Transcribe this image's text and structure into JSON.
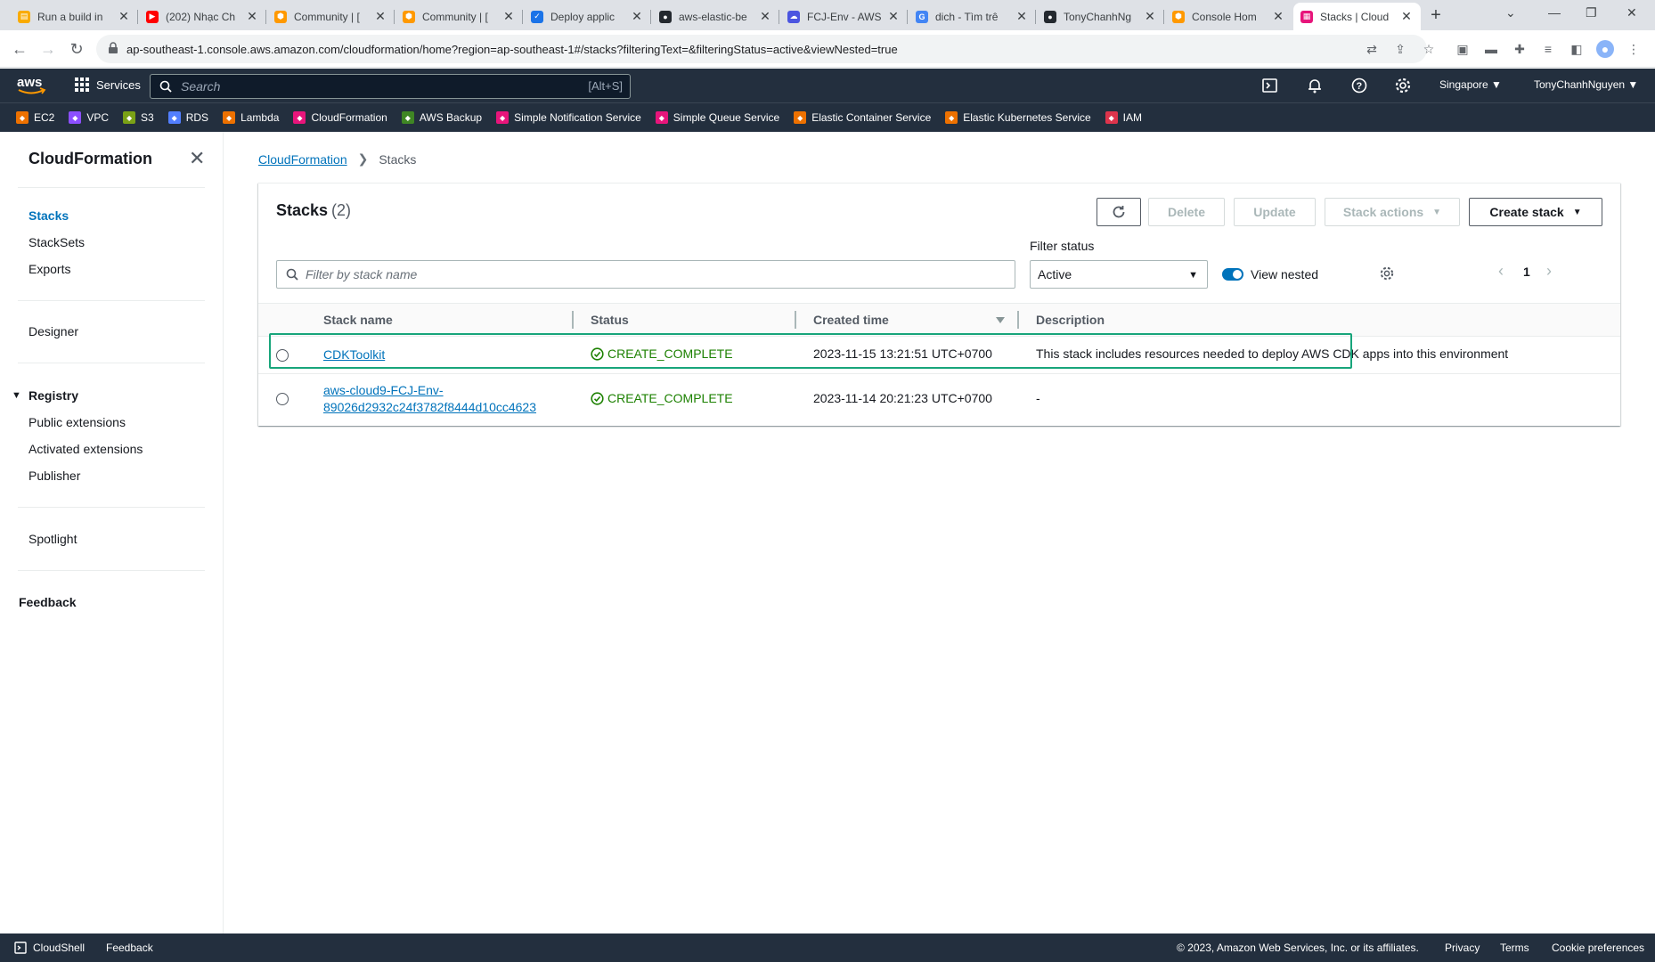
{
  "browser": {
    "tabs": [
      {
        "title": "Run a build in",
        "color": "#f9ab00",
        "glyph": "▤"
      },
      {
        "title": "(202) Nhạc Ch",
        "color": "#ff0000",
        "glyph": "▶"
      },
      {
        "title": "Community | [",
        "color": "#ff9900",
        "glyph": "⬢"
      },
      {
        "title": "Community | [",
        "color": "#ff9900",
        "glyph": "⬢"
      },
      {
        "title": "Deploy applic",
        "color": "#1a73e8",
        "glyph": "✓"
      },
      {
        "title": "aws-elastic-be",
        "color": "#24292f",
        "glyph": "●"
      },
      {
        "title": "FCJ-Env - AWS",
        "color": "#4b55e0",
        "glyph": "☁"
      },
      {
        "title": "dich - Tìm trê",
        "color": "#4285f4",
        "glyph": "G"
      },
      {
        "title": "TonyChanhNg",
        "color": "#24292f",
        "glyph": "●"
      },
      {
        "title": "Console Hom",
        "color": "#ff9900",
        "glyph": "⬢"
      },
      {
        "title": "Stacks | Cloud",
        "color": "#e7157b",
        "glyph": "▦"
      }
    ],
    "new_tab": "+",
    "url": "ap-southeast-1.console.aws.amazon.com/cloudformation/home?region=ap-southeast-1#/stacks?filteringText=&filteringStatus=active&viewNested=true"
  },
  "awsnav": {
    "logo": "aws",
    "services_label": "Services",
    "search_placeholder": "Search",
    "search_shortcut": "[Alt+S]",
    "region": "Singapore ▼",
    "user": "TonyChanhNguyen ▼"
  },
  "favorites": [
    {
      "label": "EC2",
      "color": "#ed7100"
    },
    {
      "label": "VPC",
      "color": "#8c4fff"
    },
    {
      "label": "S3",
      "color": "#7aa116"
    },
    {
      "label": "RDS",
      "color": "#527fff"
    },
    {
      "label": "Lambda",
      "color": "#ed7100"
    },
    {
      "label": "CloudFormation",
      "color": "#e7157b"
    },
    {
      "label": "AWS Backup",
      "color": "#3f8624"
    },
    {
      "label": "Simple Notification Service",
      "color": "#e7157b"
    },
    {
      "label": "Simple Queue Service",
      "color": "#e7157b"
    },
    {
      "label": "Elastic Container Service",
      "color": "#ed7100"
    },
    {
      "label": "Elastic Kubernetes Service",
      "color": "#ed7100"
    },
    {
      "label": "IAM",
      "color": "#dd344c"
    }
  ],
  "sidenav": {
    "title": "CloudFormation",
    "stacks": "Stacks",
    "stacksets": "StackSets",
    "exports": "Exports",
    "designer": "Designer",
    "registry": "Registry",
    "public_extensions": "Public extensions",
    "activated_extensions": "Activated extensions",
    "publisher": "Publisher",
    "spotlight": "Spotlight",
    "feedback": "Feedback"
  },
  "breadcrumb": {
    "root": "CloudFormation",
    "current": "Stacks"
  },
  "panel": {
    "title": "Stacks",
    "count": "(2)",
    "delete": "Delete",
    "update": "Update",
    "stack_actions": "Stack actions",
    "create_stack": "Create stack",
    "filter_placeholder": "Filter by stack name",
    "filter_status_label": "Filter status",
    "filter_status_value": "Active",
    "view_nested": "View nested",
    "page": "1"
  },
  "table": {
    "headers": {
      "name": "Stack name",
      "status": "Status",
      "created": "Created time",
      "description": "Description"
    },
    "rows": [
      {
        "name": "CDKToolkit",
        "status": "CREATE_COMPLETE",
        "created": "2023-11-15 13:21:51 UTC+0700",
        "description": "This stack includes resources needed to deploy AWS CDK apps into this environment"
      },
      {
        "name_line1": "aws-cloud9-FCJ-Env-",
        "name_line2": "89026d2932c24f3782f8444d10cc4623",
        "status": "CREATE_COMPLETE",
        "created": "2023-11-14 20:21:23 UTC+0700",
        "description": "-"
      }
    ]
  },
  "footer": {
    "cloudshell": "CloudShell",
    "feedback": "Feedback",
    "copyright": "© 2023, Amazon Web Services, Inc. or its affiliates.",
    "privacy": "Privacy",
    "terms": "Terms",
    "cookie": "Cookie preferences"
  }
}
